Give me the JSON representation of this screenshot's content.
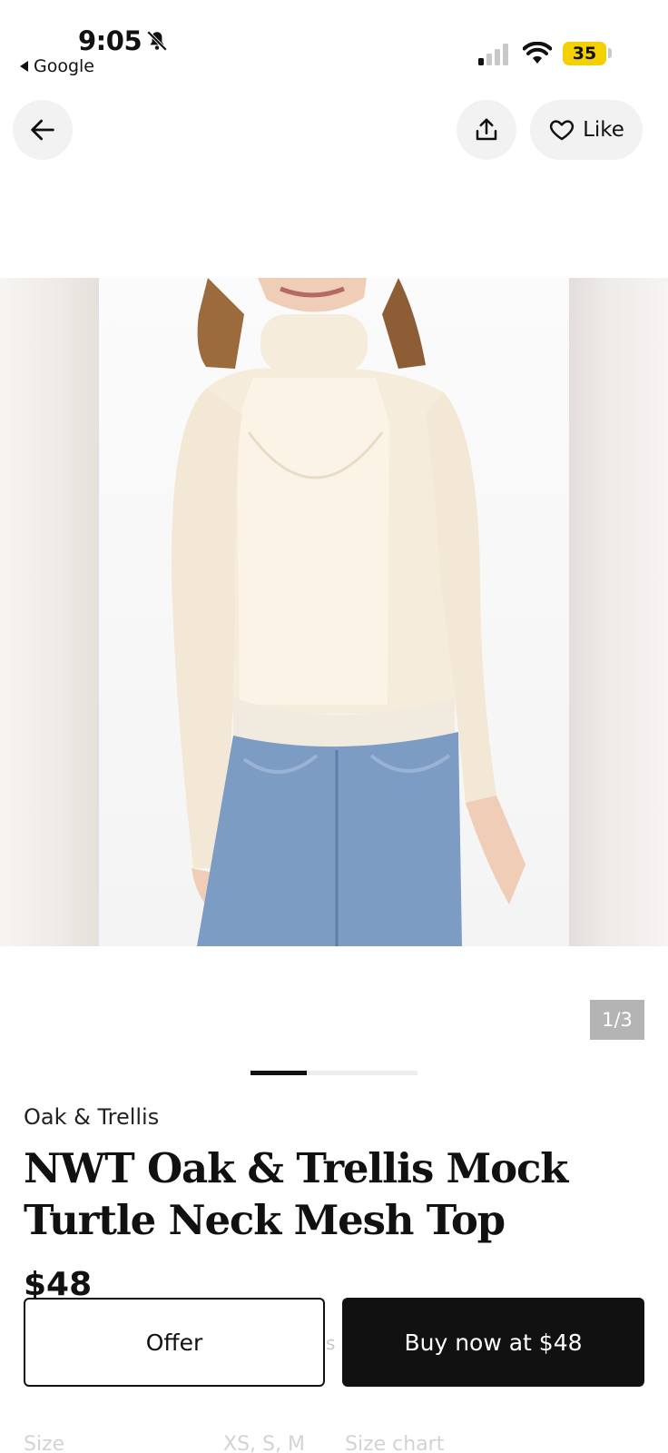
{
  "status_bar": {
    "time": "9:05",
    "back_app": "Google",
    "battery": "35",
    "icons": [
      "bell-slash-icon",
      "signal-icon",
      "wifi-icon",
      "battery-icon"
    ]
  },
  "nav": {
    "back_icon": "arrow-left-icon",
    "share_icon": "share-icon",
    "like_icon": "heart-icon",
    "like_label": "Like"
  },
  "gallery": {
    "page_indicator": "1/3",
    "current_index": 1,
    "total": 3,
    "image_description_hint": "woman wearing cream mesh turtleneck top and blue jeans"
  },
  "product": {
    "brand": "Oak & Trellis",
    "title": "NWT Oak & Trellis Mock Turtle Neck Mesh Top",
    "price": "$48"
  },
  "actions": {
    "offer_label": "Offer",
    "buy_label": "Buy now at $48",
    "hidden_text": "s"
  },
  "details_row": {
    "size_label": "Size",
    "size_values": "XS, S, M",
    "size_chart": "Size chart"
  },
  "colors": {
    "accent": "#111111",
    "battery": "#f5d000",
    "button_bg": "#f2f2f2",
    "badge_bg": "#b4b4b4"
  }
}
